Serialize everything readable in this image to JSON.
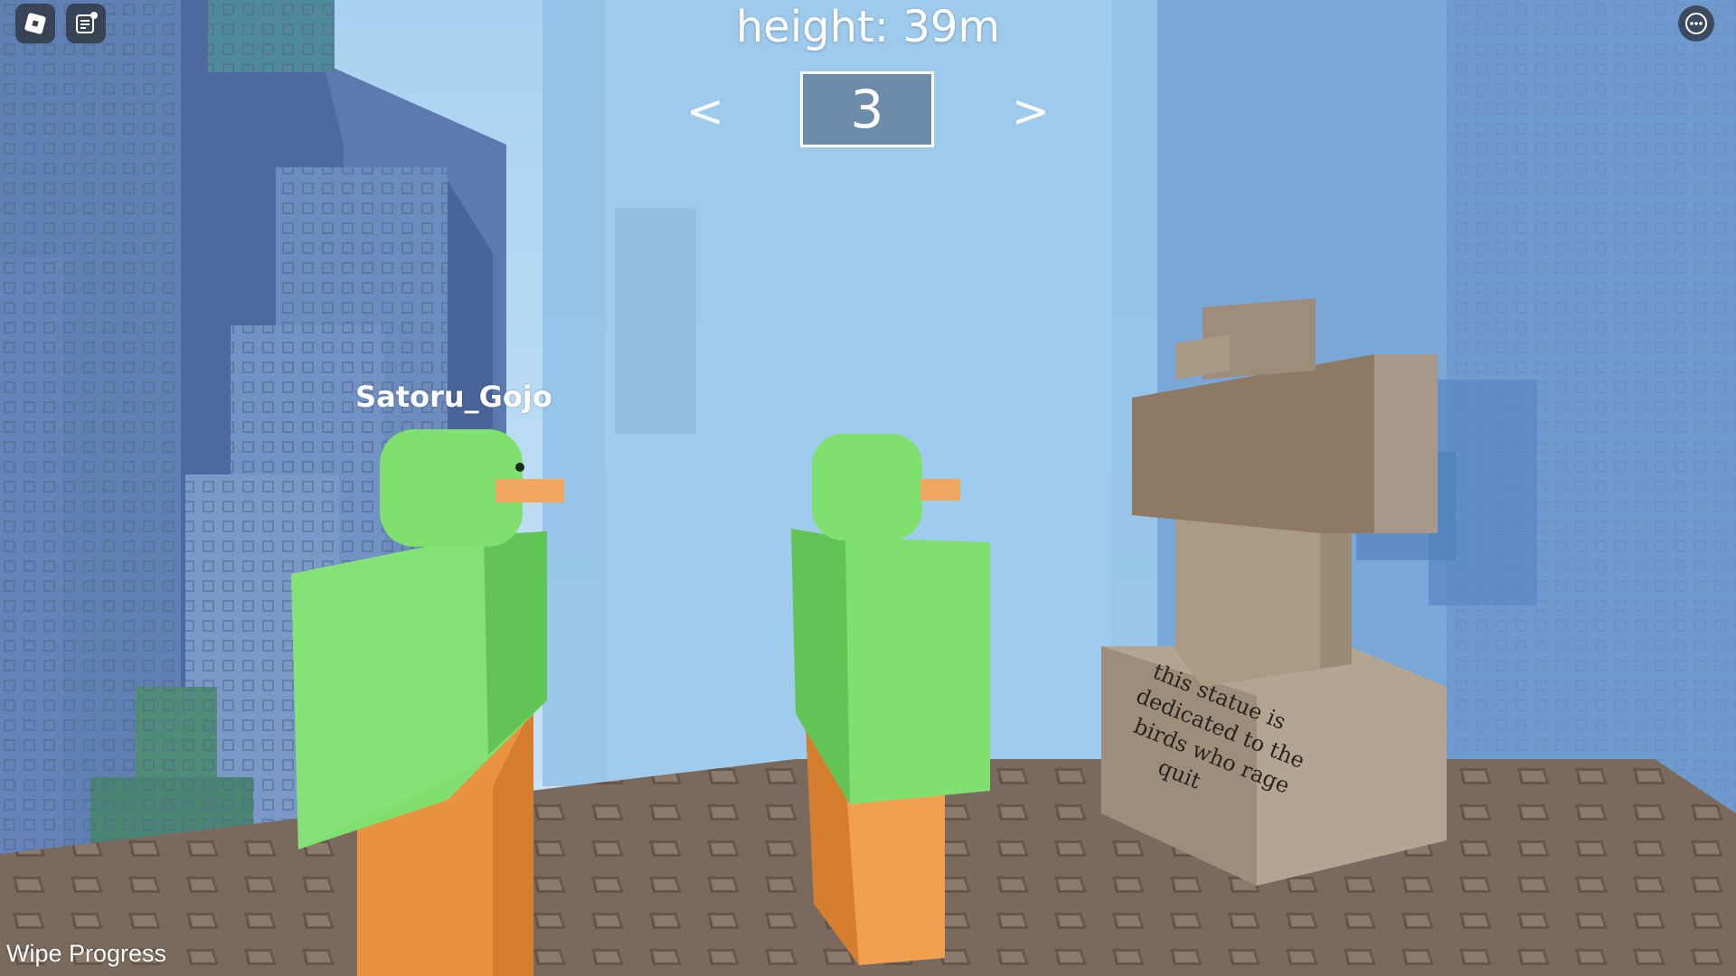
{
  "hud": {
    "height_text": "height: 39m",
    "level": "3",
    "prev_arrow": "<",
    "next_arrow": ">",
    "wipe_progress": "Wipe Progress"
  },
  "player": {
    "name": "Satoru_Gojo"
  },
  "statue": {
    "plaque_lines": [
      "this statue is",
      "dedicated to the",
      "birds who rage",
      "quit"
    ]
  },
  "icons": {
    "menu": "roblox-logo-icon",
    "chat": "chat-icon",
    "more": "more-options-icon"
  },
  "colors": {
    "bird_body": "#7fe070",
    "bird_legs": "#f0a050",
    "beak": "#f0a860",
    "floor": "#7a6a5e",
    "statue": "#a08c76",
    "sky": "#9cc6ea"
  }
}
